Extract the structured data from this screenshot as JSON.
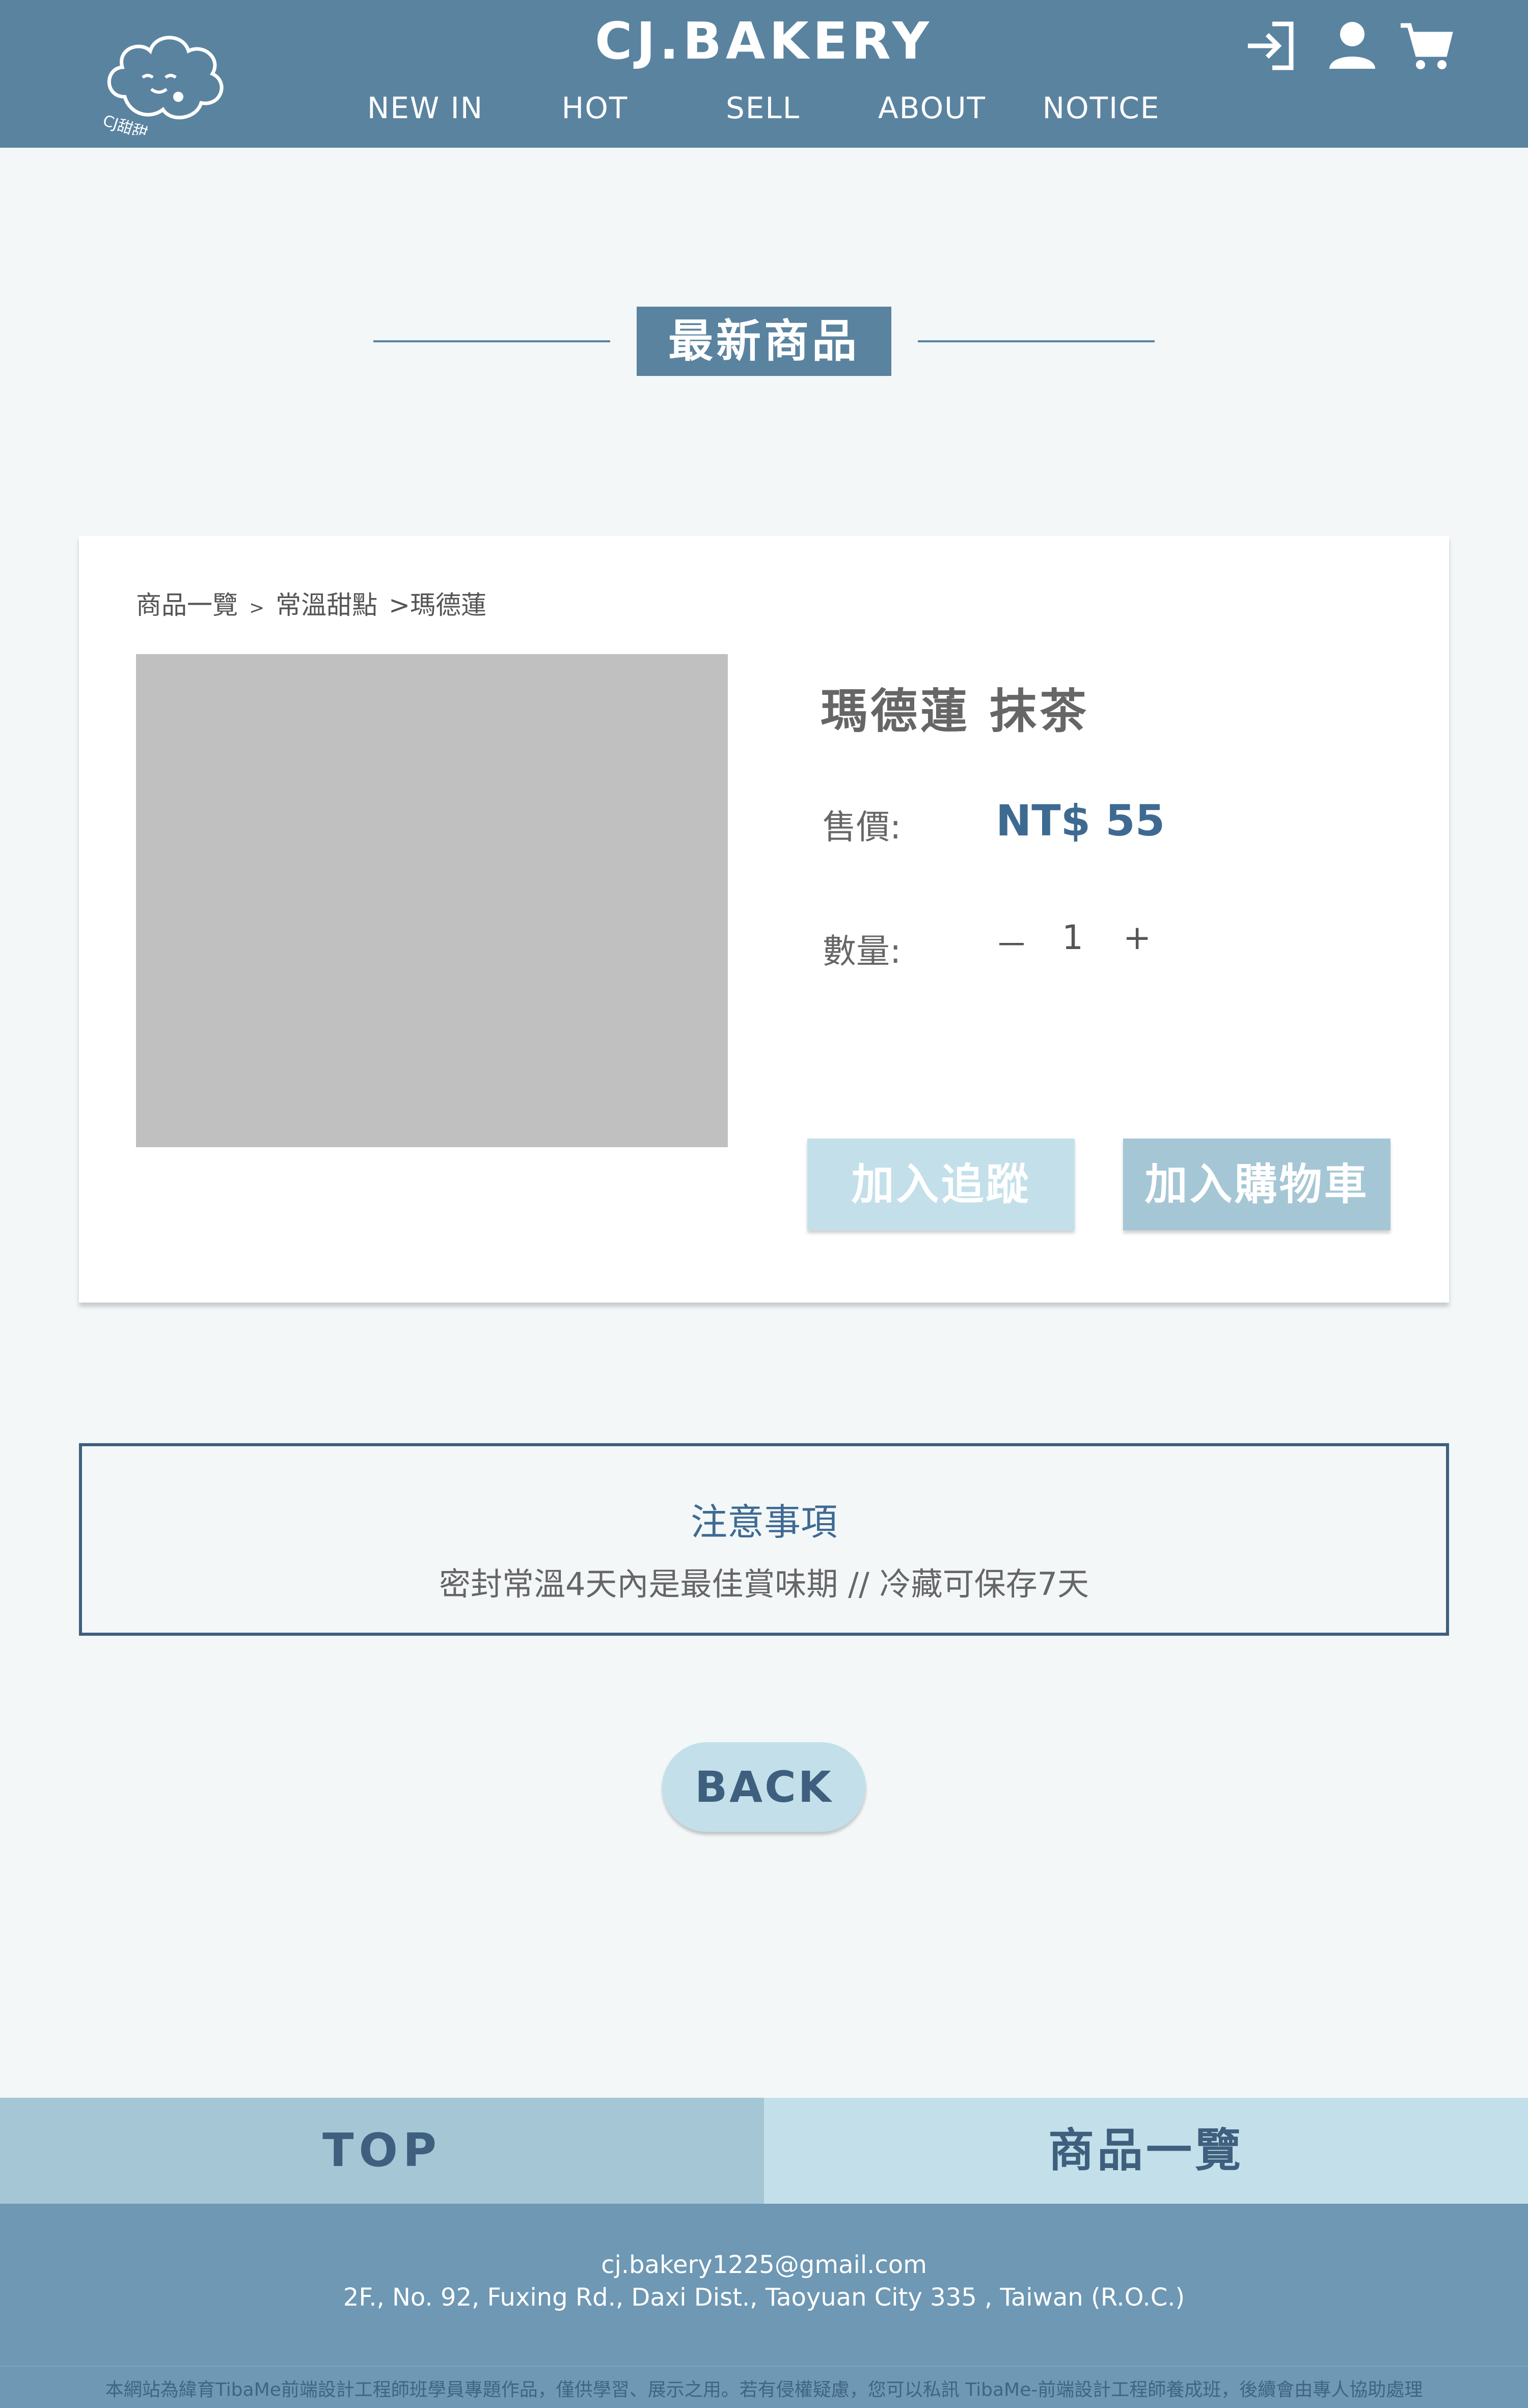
{
  "header": {
    "brand": "CJ.BAKERY",
    "logo_icon": "cloud-mascot-logo",
    "nav": [
      "NEW IN",
      "HOT",
      "SELL",
      "ABOUT",
      "NOTICE"
    ],
    "icons": [
      "login-icon",
      "user-icon",
      "cart-icon"
    ]
  },
  "section": {
    "title": "最新商品"
  },
  "product": {
    "breadcrumb": [
      "商品一覽",
      ">",
      "常溫甜點",
      ">瑪德蓮"
    ],
    "name": "瑪德蓮 抹茶",
    "price_label": "售價:",
    "price": "NT$ 55",
    "qty_label": "數量:",
    "qty_minus": "－",
    "qty_value": "1",
    "qty_plus": "+",
    "wishlist_button": "加入追蹤",
    "cart_button": "加入購物車"
  },
  "notice": {
    "title": "注意事項",
    "text": "密封常溫4天內是最佳賞味期 // 冷藏可保存7天"
  },
  "back_button": "BACK",
  "footer": {
    "top_button": "TOP",
    "list_button": "商品一覽",
    "email": "cj.bakery1225@gmail.com",
    "address": "2F., No. 92, Fuxing Rd., Daxi Dist., Taoyuan City 335 , Taiwan (R.O.C.)",
    "disclaimer": "本網站為緯育TibaMe前端設計工程師班學員專題作品，僅供學習、展示之用。若有侵權疑慮，您可以私訊 TibaMe-前端設計工程師養成班，後續會由專人協助處理"
  },
  "colors": {
    "header_bg": "#5a83a0",
    "accent": "#3e6a92",
    "wishlist_btn": "#c3e0ea",
    "cart_btn": "#a5c6d5",
    "footer_bg": "#6e98b3"
  }
}
